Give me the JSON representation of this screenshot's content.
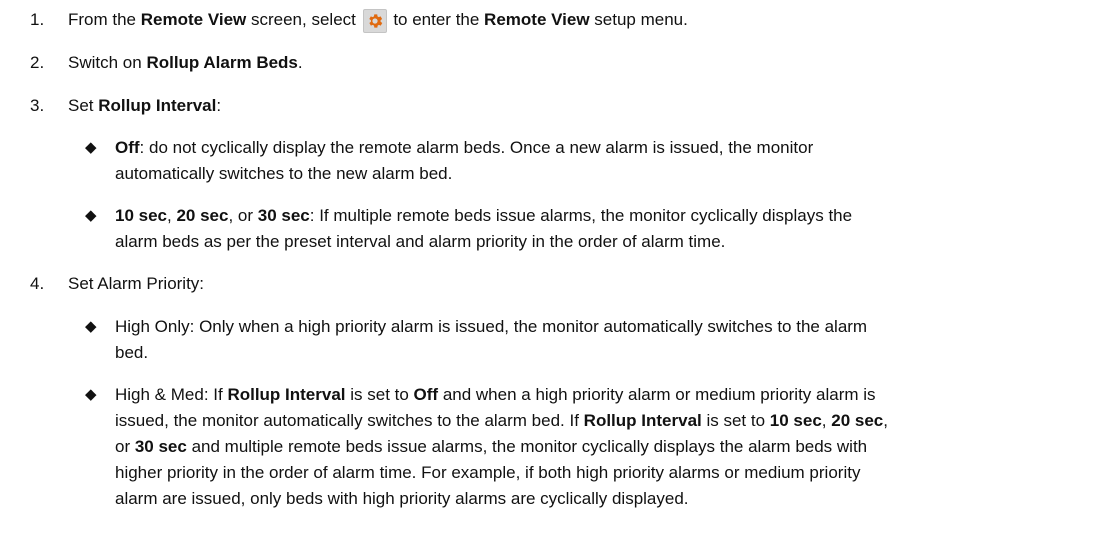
{
  "steps": [
    {
      "number": "1.",
      "p1": "From the ",
      "b1": "Remote View",
      "p2": " screen, select ",
      "icon": "gear-icon",
      "p3": " to enter the ",
      "b2": "Remote View",
      "p4": " setup menu."
    },
    {
      "number": "2.",
      "p1": "Switch on ",
      "b1": "Rollup Alarm Beds",
      "p2": "."
    },
    {
      "number": "3.",
      "p1": "Set ",
      "b1": "Rollup Interval",
      "p2": ":",
      "bullets": [
        {
          "b1": "Off",
          "t1": ": do not cyclically display the remote alarm beds. Once a new alarm is issued, the monitor",
          "l2": "automatically switches to the new alarm bed."
        },
        {
          "b1": "10 sec",
          "t1": ", ",
          "b2": "20 sec",
          "t2": ", or ",
          "b3": "30 sec",
          "t3": ": If multiple remote beds issue alarms, the monitor cyclically displays the",
          "l2": "alarm beds as per the preset interval and alarm priority in the order of alarm time."
        }
      ]
    },
    {
      "number": "4.",
      "p1": "Set Alarm Priority:",
      "bullets": [
        {
          "l1": "High Only: Only when a high priority alarm is issued, the monitor automatically switches to the alarm",
          "l2": "bed."
        },
        {
          "l1a": "High & Med: If ",
          "l1b": "Rollup Interval",
          "l1c": " is set to ",
          "l1d": "Off",
          "l1e": " and when a high priority alarm or medium priority alarm is",
          "l2a": "issued, the monitor automatically switches to the alarm bed. If ",
          "l2b": "Rollup Interval",
          "l2c": " is set to ",
          "l2d": "10 sec",
          "l2e": ", ",
          "l2f": "20 sec",
          "l2g": ",",
          "l3a": "or ",
          "l3b": "30 sec",
          "l3c": " and multiple remote beds issue alarms, the monitor cyclically displays the alarm beds with",
          "l4": "higher priority in the order of alarm time. For example, if both high priority alarms or medium priority",
          "l5": "alarm are issued, only beds with high priority alarms are cyclically displayed."
        }
      ]
    }
  ],
  "bullet_glyph": "◆"
}
